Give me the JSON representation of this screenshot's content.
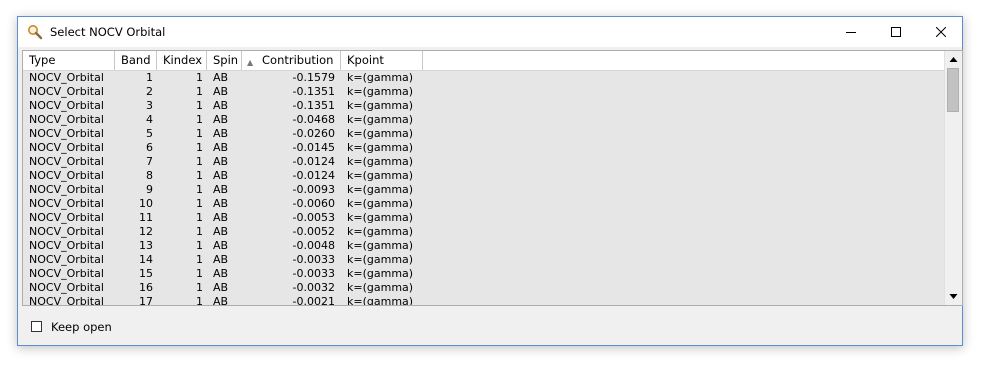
{
  "window": {
    "title": "Select NOCV Orbital",
    "icon": "magnifier-icon"
  },
  "columns": [
    {
      "label": "Type"
    },
    {
      "label": "Band"
    },
    {
      "label": "Kindex"
    },
    {
      "label": "Spin"
    },
    {
      "label": "Contribution",
      "sorted": "ascending"
    },
    {
      "label": "Kpoint"
    }
  ],
  "rows": [
    {
      "type": "NOCV_Orbital",
      "band": "1",
      "kindex": "1",
      "spin": "AB",
      "contribution": "-0.1579",
      "kpoint": "k=(gamma)"
    },
    {
      "type": "NOCV_Orbital",
      "band": "2",
      "kindex": "1",
      "spin": "AB",
      "contribution": "-0.1351",
      "kpoint": "k=(gamma)"
    },
    {
      "type": "NOCV_Orbital",
      "band": "3",
      "kindex": "1",
      "spin": "AB",
      "contribution": "-0.1351",
      "kpoint": "k=(gamma)"
    },
    {
      "type": "NOCV_Orbital",
      "band": "4",
      "kindex": "1",
      "spin": "AB",
      "contribution": "-0.0468",
      "kpoint": "k=(gamma)"
    },
    {
      "type": "NOCV_Orbital",
      "band": "5",
      "kindex": "1",
      "spin": "AB",
      "contribution": "-0.0260",
      "kpoint": "k=(gamma)"
    },
    {
      "type": "NOCV_Orbital",
      "band": "6",
      "kindex": "1",
      "spin": "AB",
      "contribution": "-0.0145",
      "kpoint": "k=(gamma)"
    },
    {
      "type": "NOCV_Orbital",
      "band": "7",
      "kindex": "1",
      "spin": "AB",
      "contribution": "-0.0124",
      "kpoint": "k=(gamma)"
    },
    {
      "type": "NOCV_Orbital",
      "band": "8",
      "kindex": "1",
      "spin": "AB",
      "contribution": "-0.0124",
      "kpoint": "k=(gamma)"
    },
    {
      "type": "NOCV_Orbital",
      "band": "9",
      "kindex": "1",
      "spin": "AB",
      "contribution": "-0.0093",
      "kpoint": "k=(gamma)"
    },
    {
      "type": "NOCV_Orbital",
      "band": "10",
      "kindex": "1",
      "spin": "AB",
      "contribution": "-0.0060",
      "kpoint": "k=(gamma)"
    },
    {
      "type": "NOCV_Orbital",
      "band": "11",
      "kindex": "1",
      "spin": "AB",
      "contribution": "-0.0053",
      "kpoint": "k=(gamma)"
    },
    {
      "type": "NOCV_Orbital",
      "band": "12",
      "kindex": "1",
      "spin": "AB",
      "contribution": "-0.0052",
      "kpoint": "k=(gamma)"
    },
    {
      "type": "NOCV_Orbital",
      "band": "13",
      "kindex": "1",
      "spin": "AB",
      "contribution": "-0.0048",
      "kpoint": "k=(gamma)"
    },
    {
      "type": "NOCV_Orbital",
      "band": "14",
      "kindex": "1",
      "spin": "AB",
      "contribution": "-0.0033",
      "kpoint": "k=(gamma)"
    },
    {
      "type": "NOCV_Orbital",
      "band": "15",
      "kindex": "1",
      "spin": "AB",
      "contribution": "-0.0033",
      "kpoint": "k=(gamma)"
    },
    {
      "type": "NOCV_Orbital",
      "band": "16",
      "kindex": "1",
      "spin": "AB",
      "contribution": "-0.0032",
      "kpoint": "k=(gamma)"
    },
    {
      "type": "NOCV_Orbital",
      "band": "17",
      "kindex": "1",
      "spin": "AB",
      "contribution": "-0.0021",
      "kpoint": "k=(gamma)"
    }
  ],
  "footer": {
    "keep_open_label": "Keep open",
    "keep_open_checked": false
  },
  "colors": {
    "list_background": "#e6e6e6",
    "window_border": "#5b8fd0"
  }
}
